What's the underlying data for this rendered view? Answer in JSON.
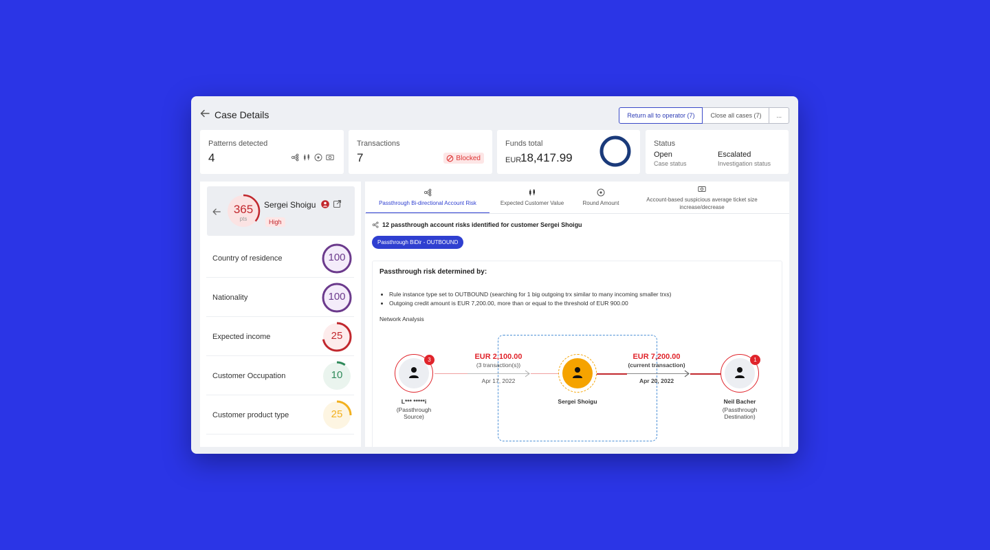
{
  "header": {
    "title": "Case Details",
    "buttons": {
      "return_all": "Return all to operator (7)",
      "close_all": "Close all cases (7)",
      "more": "..."
    }
  },
  "stats": {
    "patterns": {
      "label": "Patterns detected",
      "value": "4",
      "icons": [
        "network-icon",
        "candlestick-icon",
        "target-circle-icon",
        "cash-icon"
      ]
    },
    "transactions": {
      "label": "Transactions",
      "value": "7",
      "badge": "Blocked"
    },
    "funds": {
      "label": "Funds total",
      "currency": "EUR",
      "value": "18,417.99"
    },
    "status": {
      "label": "Status",
      "case_status": {
        "value": "Open",
        "caption": "Case status"
      },
      "investigation_status": {
        "value": "Escalated",
        "caption": "Investigation status"
      }
    }
  },
  "profile": {
    "score": "365",
    "score_unit": "pts",
    "score_fraction": 0.36,
    "name": "Sergei Shoigu",
    "risk_level": "High",
    "factors": [
      {
        "label": "Country of residence",
        "value": "100",
        "fraction": 1.0,
        "color": "#6b3a8c",
        "bg": "#f4ecfa"
      },
      {
        "label": "Nationality",
        "value": "100",
        "fraction": 1.0,
        "color": "#6b3a8c",
        "bg": "#f4ecfa"
      },
      {
        "label": "Expected income",
        "value": "25",
        "fraction": 0.72,
        "color": "#c1272d",
        "bg": "#fdecec"
      },
      {
        "label": "Customer Occupation",
        "value": "10",
        "fraction": 0.1,
        "color": "#2f8a5a",
        "bg": "#eaf4ee"
      },
      {
        "label": "Customer product type",
        "value": "25",
        "fraction": 0.25,
        "color": "#f2b01e",
        "bg": "#fdf5e2"
      }
    ]
  },
  "tabs": [
    {
      "label": "Passthrough Bi-directional Account Risk",
      "icon": "network-icon",
      "active": true
    },
    {
      "label": "Expected Customer Value",
      "icon": "candlestick-icon",
      "active": false
    },
    {
      "label": "Round Amount",
      "icon": "target-circle-icon",
      "active": false
    },
    {
      "label": "Account-based suspicious average ticket size increase/decrease",
      "icon": "cash-icon",
      "active": false
    }
  ],
  "risk_summary": "12 passthrough account risks identified for customer Sergei Shoigu",
  "filter_pill": "Passthrough BiDir - OUTBOUND",
  "detail": {
    "heading": "Passthrough risk determined by:",
    "bullets": [
      "Rule instance type set to OUTBOUND (searching for 1 big outgoing trx similar to many incoming smaller trxs)",
      "Outgoing credit amount is EUR 7,200.00, more than or equal to the threshold of EUR 900.00"
    ],
    "network_title": "Network Analysis"
  },
  "network": {
    "source": {
      "name": "L*** *****i",
      "role": "(Passthrough Source)",
      "badge": "3"
    },
    "center": {
      "name": "Sergei Shoigu"
    },
    "destination": {
      "name": "Neil Bacher",
      "role": "(Passthrough Destination)",
      "badge": "1"
    },
    "edge_in": {
      "amount": "EUR 2,100.00",
      "note": "(3 transaction(s))",
      "date": "Apr 17, 2022"
    },
    "edge_out": {
      "amount": "EUR 7,200.00",
      "note": "(current transaction)",
      "date": "Apr 20, 2022"
    }
  }
}
